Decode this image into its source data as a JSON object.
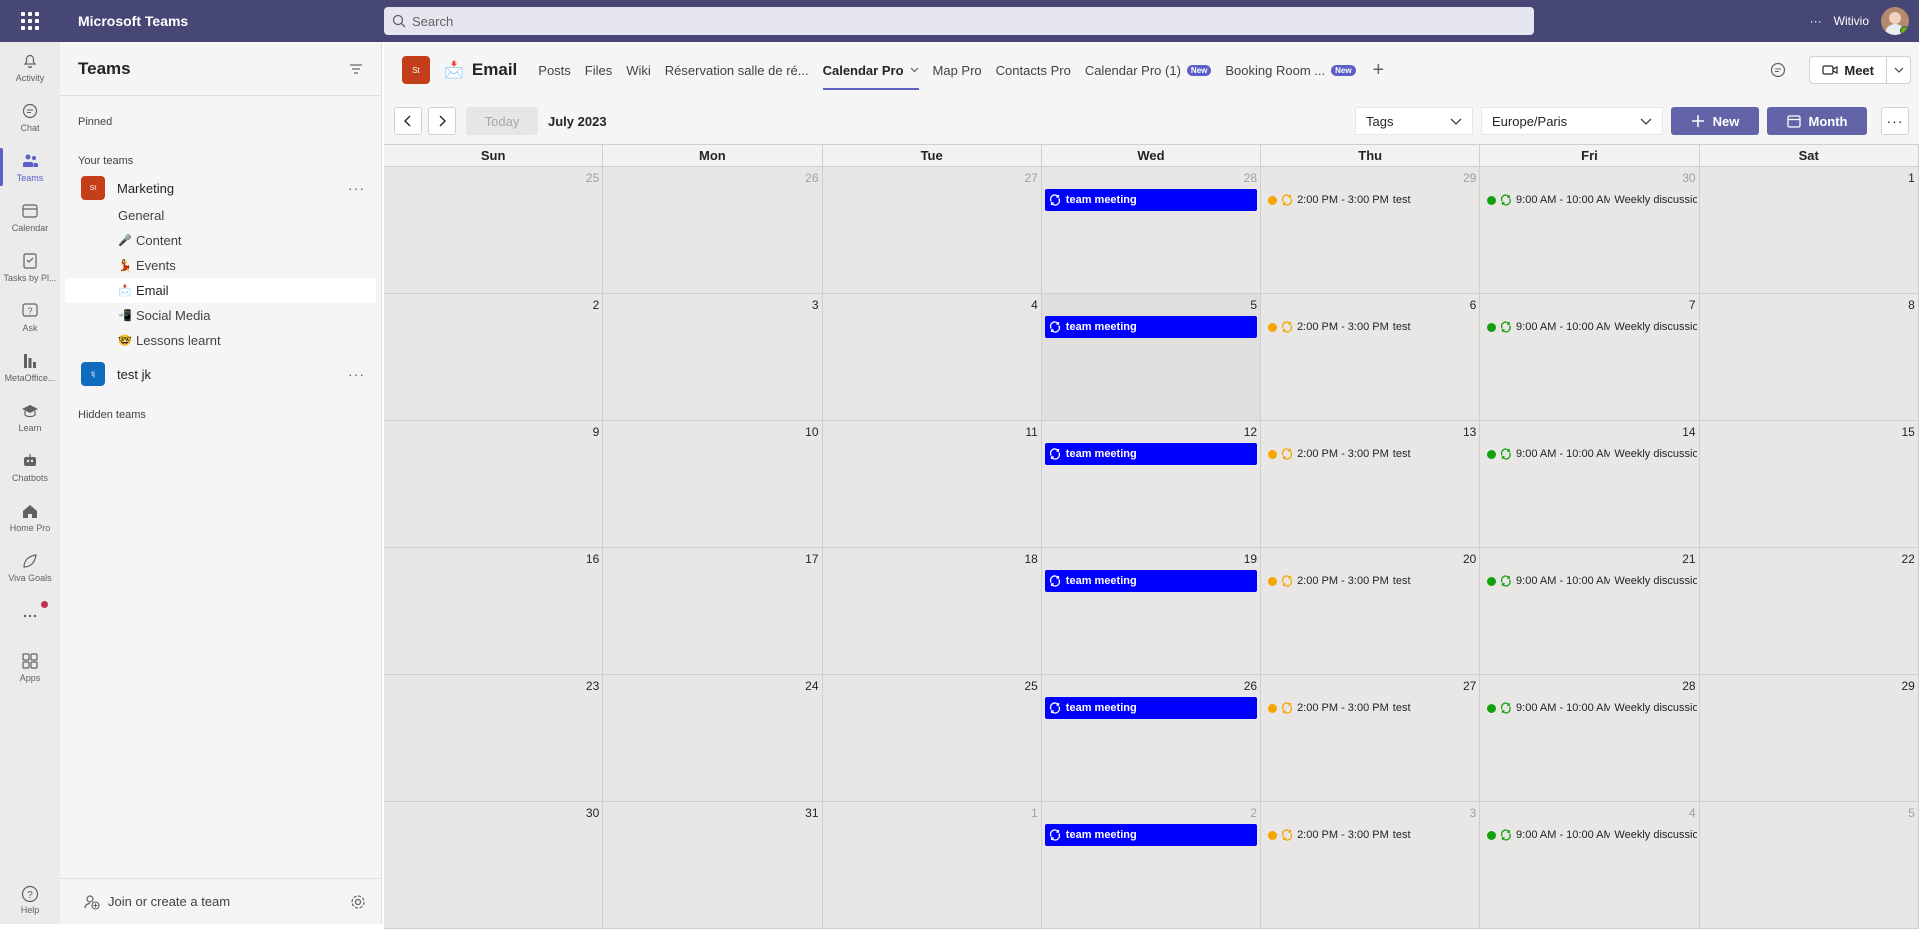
{
  "app": {
    "title": "Microsoft Teams",
    "search_placeholder": "Search",
    "user_name": "Witivio",
    "more_label": "···"
  },
  "rail": [
    {
      "label": "Activity",
      "icon": "bell-icon"
    },
    {
      "label": "Chat",
      "icon": "chat-icon"
    },
    {
      "label": "Teams",
      "icon": "teams-icon",
      "active": true
    },
    {
      "label": "Calendar",
      "icon": "calendar-icon"
    },
    {
      "label": "Tasks by Pl...",
      "icon": "tasks-icon"
    },
    {
      "label": "Ask",
      "icon": "question-icon"
    },
    {
      "label": "MetaOffice...",
      "icon": "metaoffice-icon"
    },
    {
      "label": "Learn",
      "icon": "learn-icon"
    },
    {
      "label": "Chatbots",
      "icon": "bot-icon"
    },
    {
      "label": "Home Pro",
      "icon": "home-icon"
    },
    {
      "label": "Viva Goals",
      "icon": "goals-icon"
    },
    {
      "label": "",
      "icon": "more-icon"
    },
    {
      "label": "Apps",
      "icon": "apps-icon"
    }
  ],
  "rail_help": "Help",
  "panel": {
    "title": "Teams",
    "pinned_label": "Pinned",
    "your_teams_label": "Your teams",
    "hidden_teams_label": "Hidden teams",
    "join_label": "Join or create a team",
    "teams": [
      {
        "name": "Marketing",
        "logo": "St",
        "color": "#c43e1c"
      },
      {
        "name": "test jk",
        "logo": "tj",
        "color": "#0f6cbd"
      }
    ],
    "channels": [
      {
        "name": "General",
        "emoji": ""
      },
      {
        "name": "Content",
        "emoji": "🎤"
      },
      {
        "name": "Events",
        "emoji": "💃"
      },
      {
        "name": "Email",
        "emoji": "📩",
        "active": true
      },
      {
        "name": "Social Media",
        "emoji": "📲"
      },
      {
        "name": "Lessons learnt",
        "emoji": "🤓"
      }
    ]
  },
  "channel_header": {
    "logo": "St",
    "emoji": "📩",
    "name": "Email",
    "tabs": [
      {
        "label": "Posts"
      },
      {
        "label": "Files"
      },
      {
        "label": "Wiki"
      },
      {
        "label": "Réservation salle de ré..."
      },
      {
        "label": "Calendar Pro",
        "active": true,
        "dropdown": true
      },
      {
        "label": "Map Pro"
      },
      {
        "label": "Contacts Pro"
      },
      {
        "label": "Calendar Pro (1)",
        "badge": "New"
      },
      {
        "label": "Booking Room ...",
        "badge": "New"
      }
    ],
    "meet_label": "Meet"
  },
  "toolbar": {
    "today_label": "Today",
    "month_label": "July 2023",
    "tags_label": "Tags",
    "timezone": "Europe/Paris",
    "new_label": "New",
    "view_label": "Month"
  },
  "calendar": {
    "weekdays": [
      "Sun",
      "Mon",
      "Tue",
      "Wed",
      "Thu",
      "Fri",
      "Sat"
    ],
    "weeks": [
      [
        "25",
        "26",
        "27",
        "28",
        "29",
        "30",
        "1"
      ],
      [
        "2",
        "3",
        "4",
        "5",
        "6",
        "7",
        "8"
      ],
      [
        "9",
        "10",
        "11",
        "12",
        "13",
        "14",
        "15"
      ],
      [
        "16",
        "17",
        "18",
        "19",
        "20",
        "21",
        "22"
      ],
      [
        "23",
        "24",
        "25",
        "26",
        "27",
        "28",
        "29"
      ],
      [
        "30",
        "31",
        "1",
        "2",
        "3",
        "4",
        "5"
      ]
    ],
    "other_month": [
      [
        0,
        0
      ],
      [
        0,
        1
      ],
      [
        0,
        2
      ],
      [
        0,
        3
      ],
      [
        0,
        4
      ],
      [
        0,
        5
      ],
      [
        5,
        2
      ],
      [
        5,
        3
      ],
      [
        5,
        4
      ],
      [
        5,
        5
      ],
      [
        5,
        6
      ]
    ],
    "today": [
      1,
      3
    ],
    "events": {
      "wed": {
        "title": "team meeting",
        "color": "#0000ff"
      },
      "thu": {
        "time": "2:00 PM - 3:00 PM",
        "title": "test",
        "color": "#f7a500"
      },
      "fri": {
        "time": "9:00 AM - 10:00 AM",
        "title": "Weekly discussio",
        "color": "#13a10e"
      }
    }
  }
}
